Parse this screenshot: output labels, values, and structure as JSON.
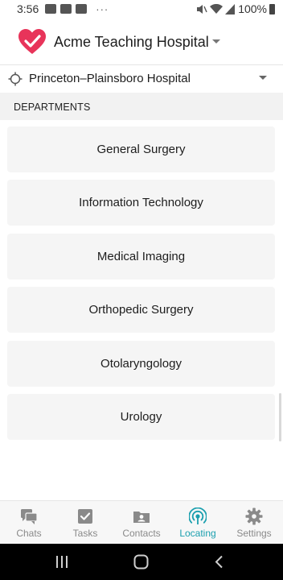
{
  "status_bar": {
    "time": "3:56",
    "dots": "···",
    "battery_percent": "100%"
  },
  "header": {
    "title": "Acme Teaching Hospital",
    "brand_color": "#e8345a"
  },
  "location": {
    "name": "Princeton–Plainsboro Hospital"
  },
  "section": {
    "title": "DEPARTMENTS"
  },
  "departments": [
    {
      "label": "General Surgery"
    },
    {
      "label": "Information Technology"
    },
    {
      "label": "Medical Imaging"
    },
    {
      "label": "Orthopedic Surgery"
    },
    {
      "label": "Otolaryngology"
    },
    {
      "label": "Urology"
    }
  ],
  "bottom_nav": {
    "active_color": "#1a9fae",
    "items": [
      {
        "label": "Chats",
        "icon": "chat-icon"
      },
      {
        "label": "Tasks",
        "icon": "tasks-icon"
      },
      {
        "label": "Contacts",
        "icon": "contacts-icon"
      },
      {
        "label": "Locating",
        "icon": "locating-icon",
        "active": true
      },
      {
        "label": "Settings",
        "icon": "gear-icon"
      }
    ]
  }
}
